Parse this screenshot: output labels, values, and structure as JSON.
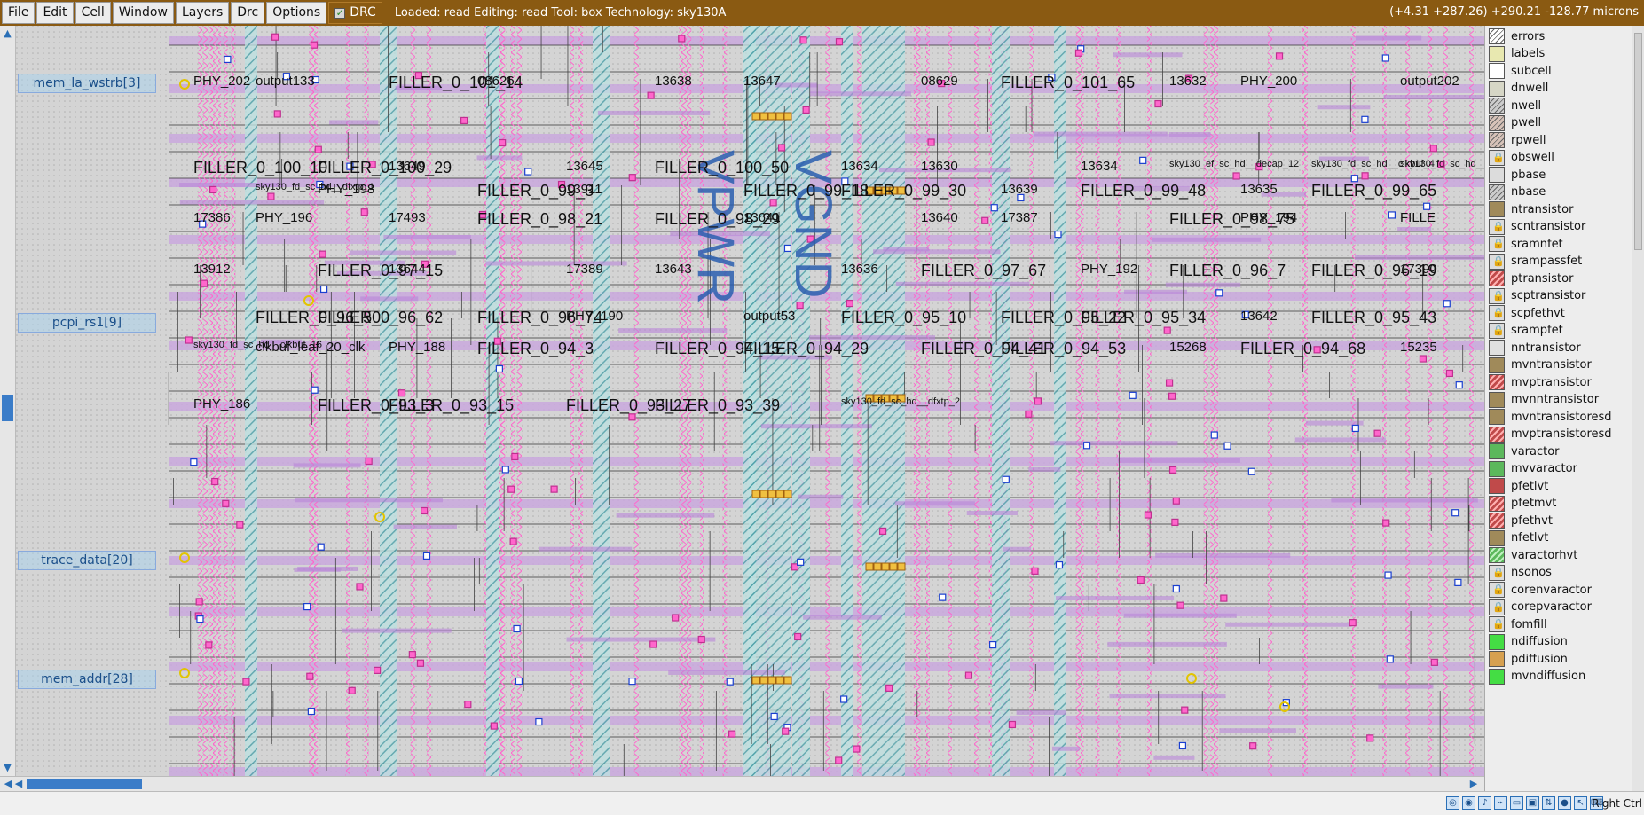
{
  "menubar": {
    "items": [
      "File",
      "Edit",
      "Cell",
      "Window",
      "Layers",
      "Drc",
      "Options"
    ],
    "drc_label": "DRC",
    "status": "Loaded: read Editing: read Tool: box  Technology: sky130A",
    "coords": "(+4.31 +287.26) +290.21 -128.77 microns"
  },
  "colors": {
    "menubar_bg": "#8a5a12",
    "accent_blue": "#2b5fb0",
    "row_purple": "#c9a8dd",
    "hatch_teal": "#4aa0a8",
    "pink_via": "#ff66cc",
    "yellow_pin": "#e2c400"
  },
  "pins": [
    "mem_la_wstrb[3]",
    "pcpi_rs1[9]",
    "trace_data[20]",
    "mem_addr[28]"
  ],
  "nets": {
    "power": "VPWR",
    "ground": "VGND"
  },
  "cell_texts": [
    "PHY_202",
    "output133",
    "FILLER_0_101_14",
    "08626",
    "13638",
    "13647",
    "08629",
    "FILLER_0_101_65",
    "13632",
    "PHY_200",
    "output202",
    "FILLER_0_100_10",
    "FILLER_0_100_29",
    "13649",
    "13645",
    "FILLER_0_100_50",
    "13634",
    "13630",
    "13634",
    "sky130_ef_sc_hd__decap_12",
    "sky130_fd_sc_hd__clkbuf_4",
    "sky130_fd_sc_hd__mux2_1",
    "sky130_fd_sc_hd__dfxtp_1",
    "PHY_198",
    "FILLER_0_99_3",
    "13911",
    "FILLER_0_99_18",
    "FILLER_0_99_30",
    "13639",
    "FILLER_0_99_48",
    "13635",
    "FILLER_0_99_65",
    "17386",
    "PHY_196",
    "17493",
    "FILLER_0_98_21",
    "FILLER_0_98_29",
    "13641",
    "13640",
    "17387",
    "FILLER_0_98_75",
    "PHY_194",
    "FILLE",
    "13912",
    "FILLER_0_97_15",
    "13644",
    "17389",
    "13643",
    "13636",
    "FILLER_0_97_67",
    "PHY_192",
    "FILLER_0_96_7",
    "FILLER_0_96_19",
    "17390",
    "FILLER_0_96_50",
    "FILLER_0_96_62",
    "FILLER_0_96_74",
    "PHY_190",
    "output53",
    "FILLER_0_95_10",
    "FILLER_0_95_22",
    "FILLER_0_95_34",
    "13642",
    "FILLER_0_95_43",
    "sky130_fd_sc_hd__clkbuf_16",
    "clkbuf_leaf_20_clk",
    "PHY_188",
    "FILLER_0_94_3",
    "FILLER_0_94_15",
    "FILLER_0_94_29",
    "FILLER_0_94_41",
    "FILLER_0_94_53",
    "15268",
    "FILLER_0_94_68",
    "15235",
    "PHY_186",
    "FILLER_0_93_3",
    "FILLER_0_93_15",
    "FILLER_0_93_27",
    "FILLER_0_93_39",
    "sky130_fd_sc_hd__dfxtp_2"
  ],
  "layers": [
    {
      "name": "errors",
      "icon": "hatched-square",
      "color": "#ffffff"
    },
    {
      "name": "labels",
      "icon": "swatch",
      "color": "#e8e8b0"
    },
    {
      "name": "subcell",
      "icon": "outline-square",
      "color": "#ffffff"
    },
    {
      "name": "dnwell",
      "icon": "swatch",
      "color": "#d6d6c6"
    },
    {
      "name": "nwell",
      "icon": "hatched-square",
      "color": "#cccccc"
    },
    {
      "name": "pwell",
      "icon": "hatched-square",
      "color": "#d6c2b8"
    },
    {
      "name": "rpwell",
      "icon": "hatched-square",
      "color": "#d6c2b8"
    },
    {
      "name": "obswell",
      "icon": "lock",
      "color": "#dcdcdc"
    },
    {
      "name": "pbase",
      "icon": "swatch",
      "color": "#dcdcdc"
    },
    {
      "name": "nbase",
      "icon": "hatched-square",
      "color": "#cccccc"
    },
    {
      "name": "ntransistor",
      "icon": "swatch",
      "color": "#a08a5a"
    },
    {
      "name": "scntransistor",
      "icon": "lock",
      "color": "#dcdcdc"
    },
    {
      "name": "sramnfet",
      "icon": "lock",
      "color": "#dcdcdc"
    },
    {
      "name": "srampassfet",
      "icon": "lock",
      "color": "#dcdcdc"
    },
    {
      "name": "ptransistor",
      "icon": "hatched-red",
      "color": "#c04a4a"
    },
    {
      "name": "scptransistor",
      "icon": "lock",
      "color": "#dcdcdc"
    },
    {
      "name": "scpfethvt",
      "icon": "lock",
      "color": "#dcdcdc"
    },
    {
      "name": "srampfet",
      "icon": "lock",
      "color": "#dcdcdc"
    },
    {
      "name": "nntransistor",
      "icon": "swatch",
      "color": "#e0e0e0"
    },
    {
      "name": "mvntransistor",
      "icon": "swatch",
      "color": "#a08a5a"
    },
    {
      "name": "mvptransistor",
      "icon": "hatched-red",
      "color": "#c04a4a"
    },
    {
      "name": "mvnntransistor",
      "icon": "swatch",
      "color": "#a08a5a"
    },
    {
      "name": "mvntransistoresd",
      "icon": "swatch",
      "color": "#a08a5a"
    },
    {
      "name": "mvptransistoresd",
      "icon": "hatched-red",
      "color": "#c04a4a"
    },
    {
      "name": "varactor",
      "icon": "swatch",
      "color": "#5cb85c"
    },
    {
      "name": "mvvaractor",
      "icon": "swatch",
      "color": "#5cb85c"
    },
    {
      "name": "pfetlvt",
      "icon": "swatch",
      "color": "#c04a4a"
    },
    {
      "name": "pfetmvt",
      "icon": "hatched-red",
      "color": "#c04a4a"
    },
    {
      "name": "pfethvt",
      "icon": "hatched-red",
      "color": "#c04a4a"
    },
    {
      "name": "nfetlvt",
      "icon": "swatch",
      "color": "#a08a5a"
    },
    {
      "name": "varactorhvt",
      "icon": "hatched-green",
      "color": "#5cb85c"
    },
    {
      "name": "nsonos",
      "icon": "lock",
      "color": "#dcdcdc"
    },
    {
      "name": "corenvaractor",
      "icon": "lock",
      "color": "#dcdcdc"
    },
    {
      "name": "corepvaractor",
      "icon": "lock",
      "color": "#dcdcdc"
    },
    {
      "name": "fomfill",
      "icon": "lock",
      "color": "#dcdcdc"
    },
    {
      "name": "ndiffusion",
      "icon": "swatch",
      "color": "#44dd44"
    },
    {
      "name": "pdiffusion",
      "icon": "swatch",
      "color": "#d6a050"
    },
    {
      "name": "mvndiffusion",
      "icon": "swatch",
      "color": "#44dd44"
    }
  ],
  "taskbar": {
    "host_key": "Right Ctrl"
  }
}
